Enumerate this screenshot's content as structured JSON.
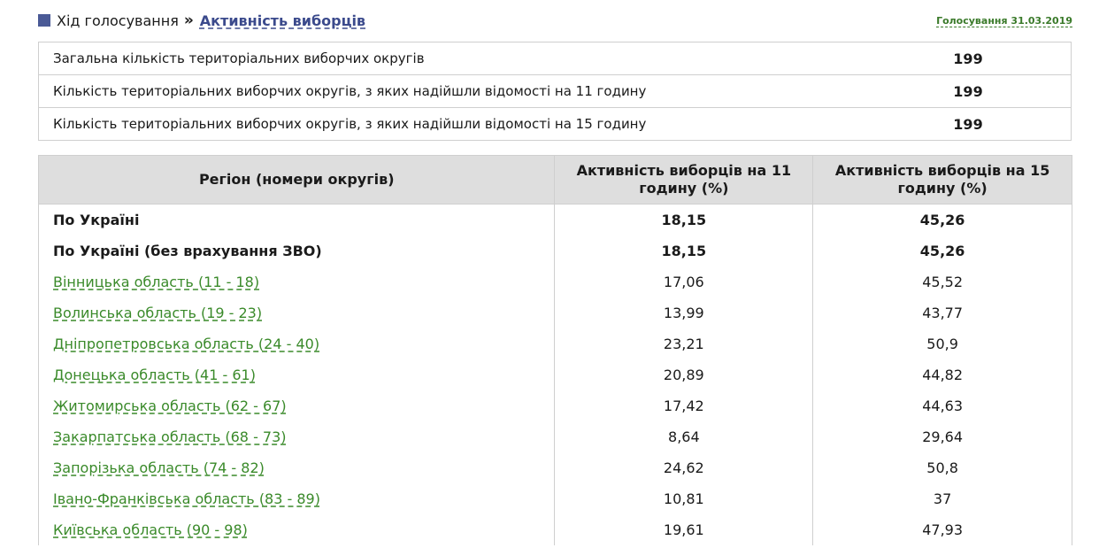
{
  "breadcrumb": {
    "parent": "Хід голосування",
    "separator": "»",
    "current": "Активність виборців"
  },
  "vote_date": "Голосування 31.03.2019",
  "summary": [
    {
      "label": "Загальна кількість територіальних виборчих округів",
      "value": "199"
    },
    {
      "label": "Кількість територіальних виборчих округів, з яких надійшли відомості на 11 годину",
      "value": "199"
    },
    {
      "label": "Кількість територіальних виборчих округів, з яких надійшли відомості на 15 годину",
      "value": "199"
    }
  ],
  "table": {
    "headers": [
      "Регіон (номери округів)",
      "Активність виборців на 11 годину (%)",
      "Активність виборців на 15 годину (%)"
    ],
    "totals": [
      {
        "region": "По Україні",
        "h11": "18,15",
        "h15": "45,26"
      },
      {
        "region": "По Україні (без врахування ЗВО)",
        "h11": "18,15",
        "h15": "45,26"
      }
    ],
    "rows": [
      {
        "region": "Вінницька область (11 - 18)",
        "h11": "17,06",
        "h15": "45,52"
      },
      {
        "region": "Волинська область (19 - 23)",
        "h11": "13,99",
        "h15": "43,77"
      },
      {
        "region": "Дніпропетровська область (24 - 40)",
        "h11": "23,21",
        "h15": "50,9"
      },
      {
        "region": "Донецька область (41 - 61)",
        "h11": "20,89",
        "h15": "44,82"
      },
      {
        "region": "Житомирська область (62 - 67)",
        "h11": "17,42",
        "h15": "44,63"
      },
      {
        "region": "Закарпатська область (68 - 73)",
        "h11": "8,64",
        "h15": "29,64"
      },
      {
        "region": "Запорізька область (74 - 82)",
        "h11": "24,62",
        "h15": "50,8"
      },
      {
        "region": "Івано-Франківська область (83 - 89)",
        "h11": "10,81",
        "h15": "37"
      },
      {
        "region": "Київська область (90 - 98)",
        "h11": "19,61",
        "h15": "47,93"
      }
    ]
  },
  "colors": {
    "link_green": "#3a8a2a",
    "breadcrumb_blue": "#3b4a8c",
    "header_bg": "#dedede"
  }
}
